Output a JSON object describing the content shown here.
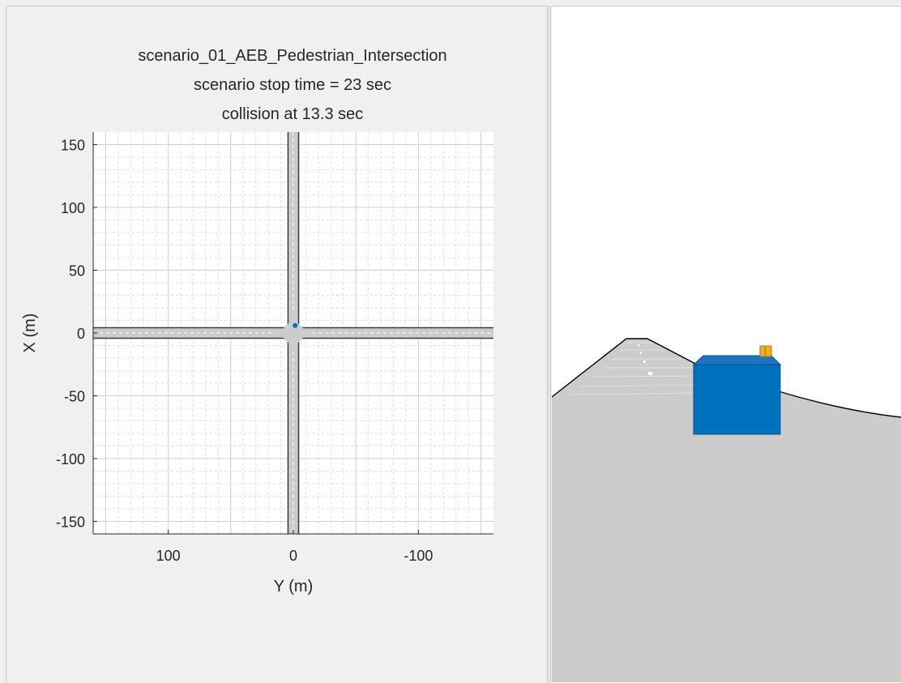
{
  "plot": {
    "title_lines": [
      "scenario_01_AEB_Pedestrian_Intersection",
      "scenario stop time = 23 sec",
      "collision at 13.3 sec"
    ],
    "xlabel": "Y (m)",
    "ylabel": "X (m)",
    "x_tick_labels": [
      "100",
      "0",
      "-100"
    ],
    "y_tick_labels": [
      "150",
      "100",
      "50",
      "0",
      "-50",
      "-100",
      "-150"
    ]
  },
  "chart_data": {
    "type": "scatter",
    "title": "scenario_01_AEB_Pedestrian_Intersection",
    "xlabel": "Y (m)",
    "ylabel": "X (m)",
    "xlim": [
      160,
      -160
    ],
    "ylim": [
      -160,
      160
    ],
    "x_ticks": [
      100,
      0,
      -100
    ],
    "y_ticks": [
      150,
      100,
      50,
      0,
      -50,
      -100,
      -150
    ],
    "grid": "on (major and minor)",
    "x_axis_reversed": true,
    "roads": [
      {
        "x": [
          160,
          -160
        ],
        "y": [
          0,
          0
        ],
        "width_m": 7.5
      },
      {
        "x": [
          0,
          0
        ],
        "y": [
          -160,
          160
        ],
        "width_m": 7.5
      }
    ],
    "points": [
      {
        "x": -1.5,
        "y": 6,
        "color": "#0072bd"
      }
    ]
  },
  "scene": {
    "ground_color": "#cccccc",
    "vehicle_color": "#0072bd",
    "pedestrian_color": "#edb120"
  }
}
